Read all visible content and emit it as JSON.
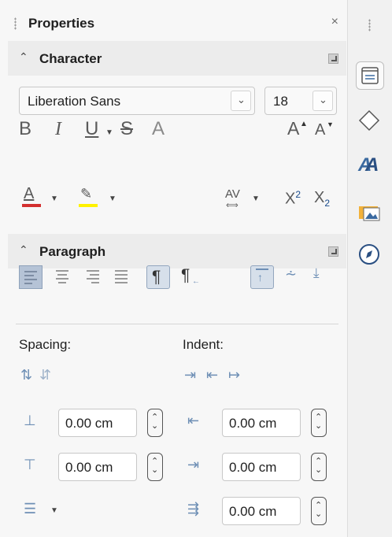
{
  "panel": {
    "title": "Properties",
    "close_glyph": "×"
  },
  "character": {
    "header": "Character",
    "font_name": "Liberation Sans",
    "font_size": "18",
    "bold": "B",
    "italic": "I",
    "underline": "U",
    "strike": "S",
    "shadow": "A",
    "grow": "A",
    "shrink": "A",
    "font_color": "A",
    "spacing": "AV",
    "superscript_base": "X",
    "superscript_exp": "2",
    "subscript_base": "X",
    "subscript_exp": "2",
    "colors": {
      "font_color_bar": "#d32f2f",
      "highlight_bar": "#fff200"
    }
  },
  "paragraph": {
    "header": "Paragraph",
    "spacing_label": "Spacing:",
    "indent_label": "Indent:",
    "above_spacing": "0.00 cm",
    "below_spacing": "0.00 cm",
    "before_indent": "0.00 cm",
    "after_indent": "0.00 cm",
    "first_line_indent": "0.00 cm"
  },
  "tabbar": {
    "icons": [
      "properties-icon",
      "shapes-icon",
      "styles-icon",
      "gallery-icon",
      "navigator-icon"
    ]
  }
}
